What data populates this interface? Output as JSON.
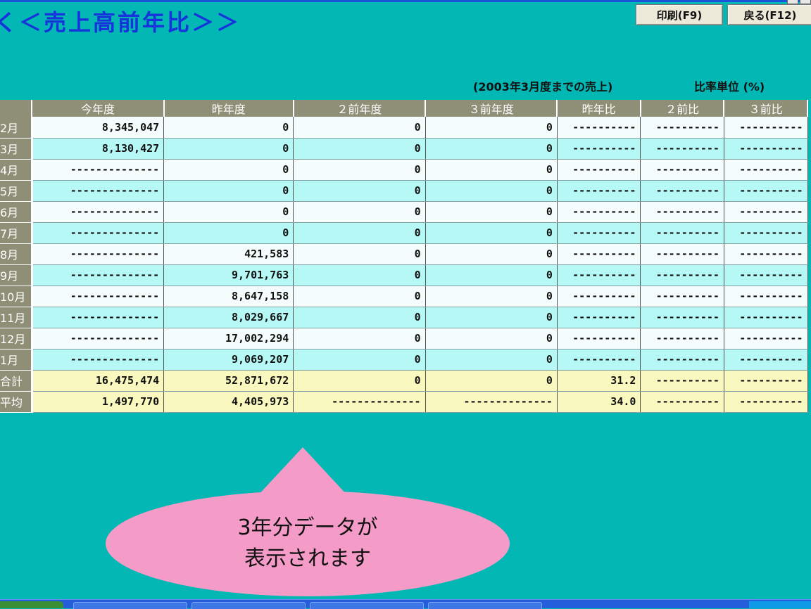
{
  "header": {
    "title": "く＜売上高前年比＞＞",
    "print_label": "印刷(F9)",
    "back_label": "戻る(F12)"
  },
  "notes": {
    "period": "(2003年3月度までの売上)",
    "unit": "比率単位 (%)"
  },
  "table": {
    "headers": [
      "",
      "今年度",
      "昨年度",
      "２前年度",
      "３前年度",
      "昨年比",
      "２前比",
      "３前比"
    ],
    "rows": [
      [
        "2月",
        "8,345,047",
        "0",
        "0",
        "0",
        "----------",
        "----------",
        "----------"
      ],
      [
        "3月",
        "8,130,427",
        "0",
        "0",
        "0",
        "----------",
        "----------",
        "----------"
      ],
      [
        "4月",
        "--------------",
        "0",
        "0",
        "0",
        "----------",
        "----------",
        "----------"
      ],
      [
        "5月",
        "--------------",
        "0",
        "0",
        "0",
        "----------",
        "----------",
        "----------"
      ],
      [
        "6月",
        "--------------",
        "0",
        "0",
        "0",
        "----------",
        "----------",
        "----------"
      ],
      [
        "7月",
        "--------------",
        "0",
        "0",
        "0",
        "----------",
        "----------",
        "----------"
      ],
      [
        "8月",
        "--------------",
        "421,583",
        "0",
        "0",
        "----------",
        "----------",
        "----------"
      ],
      [
        "9月",
        "--------------",
        "9,701,763",
        "0",
        "0",
        "----------",
        "----------",
        "----------"
      ],
      [
        "10月",
        "--------------",
        "8,647,158",
        "0",
        "0",
        "----------",
        "----------",
        "----------"
      ],
      [
        "11月",
        "--------------",
        "8,029,667",
        "0",
        "0",
        "----------",
        "----------",
        "----------"
      ],
      [
        "12月",
        "--------------",
        "17,002,294",
        "0",
        "0",
        "----------",
        "----------",
        "----------"
      ],
      [
        "1月",
        "--------------",
        "9,069,207",
        "0",
        "0",
        "----------",
        "----------",
        "----------"
      ]
    ],
    "totals": [
      [
        "合計",
        "16,475,474",
        "52,871,672",
        "0",
        "0",
        "31.2",
        "----------",
        "----------"
      ],
      [
        "平均",
        "1,497,770",
        "4,405,973",
        "--------------",
        "--------------",
        "34.0",
        "----------",
        "----------"
      ]
    ]
  },
  "callout": {
    "line1": "3年分データが",
    "line2": "表示されます"
  },
  "colors": {
    "background": "#03b7b5",
    "title": "#1733dc",
    "header_cell": "#8f8f77",
    "row_light": "#f4fdfb",
    "row_cyan": "#b6f8f6",
    "row_total": "#f9f8bf",
    "callout": "#f49cc7"
  }
}
